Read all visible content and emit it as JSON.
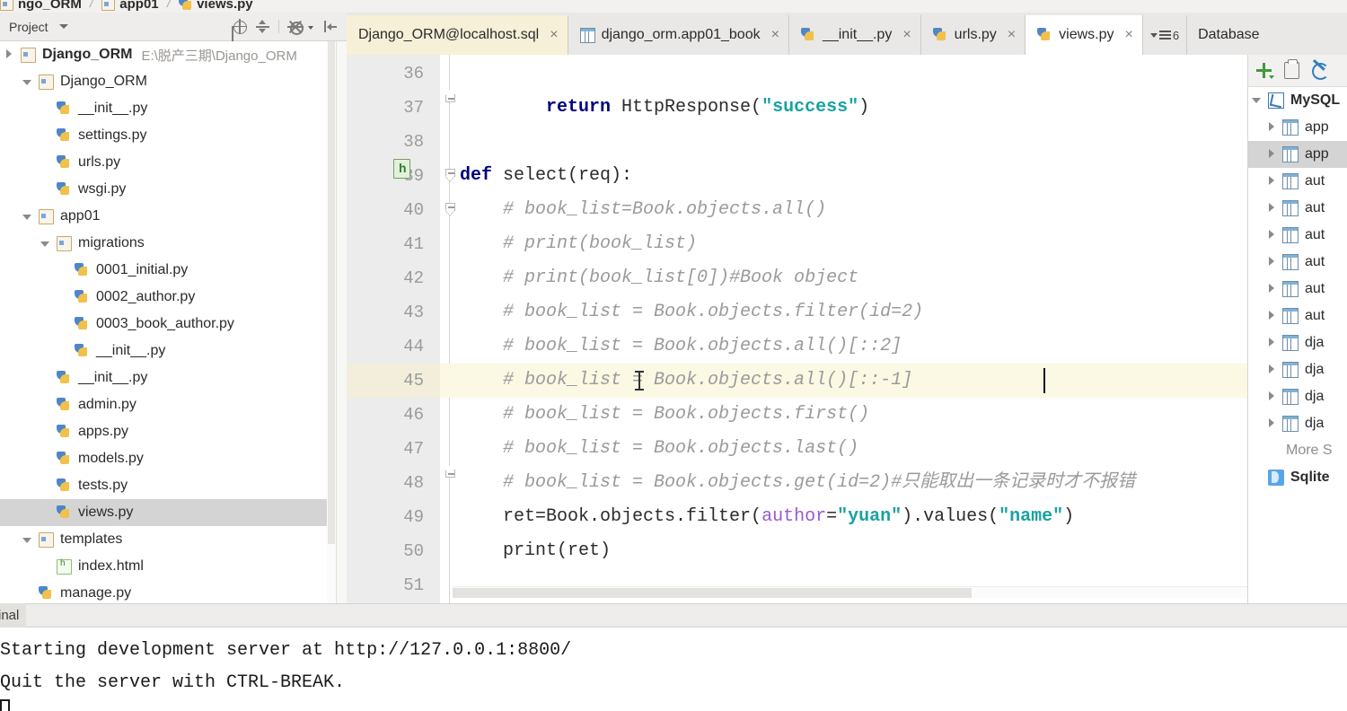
{
  "breadcrumb": {
    "items": [
      {
        "label": "ngo_ORM",
        "icon": "folder-icon"
      },
      {
        "label": "app01",
        "icon": "folder-icon"
      },
      {
        "label": "views.py",
        "icon": "python-file-icon"
      }
    ]
  },
  "project_panel": {
    "title": "Project",
    "toolbar": [
      {
        "name": "locate-file-icon"
      },
      {
        "name": "collapse-all-icon"
      },
      {
        "name": "settings-gear-icon"
      },
      {
        "name": "hide-panel-icon"
      }
    ],
    "tree": [
      {
        "label": "Django_ORM",
        "sub": "E:\\脱产三期\\Django_ORM",
        "icon": "folder-icon",
        "twisty": "closed",
        "indent": 0,
        "bold": true,
        "selected": false
      },
      {
        "label": "Django_ORM",
        "sub": "",
        "icon": "folder-icon",
        "twisty": "open",
        "indent": 1,
        "bold": false,
        "selected": false
      },
      {
        "label": "__init__.py",
        "sub": "",
        "icon": "python-file-icon",
        "twisty": "none",
        "indent": 2,
        "bold": false,
        "selected": false
      },
      {
        "label": "settings.py",
        "sub": "",
        "icon": "python-file-icon",
        "twisty": "none",
        "indent": 2,
        "bold": false,
        "selected": false
      },
      {
        "label": "urls.py",
        "sub": "",
        "icon": "python-file-icon",
        "twisty": "none",
        "indent": 2,
        "bold": false,
        "selected": false
      },
      {
        "label": "wsgi.py",
        "sub": "",
        "icon": "python-file-icon",
        "twisty": "none",
        "indent": 2,
        "bold": false,
        "selected": false
      },
      {
        "label": "app01",
        "sub": "",
        "icon": "folder-icon",
        "twisty": "open",
        "indent": 1,
        "bold": false,
        "selected": false
      },
      {
        "label": "migrations",
        "sub": "",
        "icon": "folder-icon",
        "twisty": "open",
        "indent": 2,
        "bold": false,
        "selected": false
      },
      {
        "label": "0001_initial.py",
        "sub": "",
        "icon": "python-file-icon",
        "twisty": "none",
        "indent": 3,
        "bold": false,
        "selected": false
      },
      {
        "label": "0002_author.py",
        "sub": "",
        "icon": "python-file-icon",
        "twisty": "none",
        "indent": 3,
        "bold": false,
        "selected": false
      },
      {
        "label": "0003_book_author.py",
        "sub": "",
        "icon": "python-file-icon",
        "twisty": "none",
        "indent": 3,
        "bold": false,
        "selected": false
      },
      {
        "label": "__init__.py",
        "sub": "",
        "icon": "python-file-icon",
        "twisty": "none",
        "indent": 3,
        "bold": false,
        "selected": false
      },
      {
        "label": "__init__.py",
        "sub": "",
        "icon": "python-file-icon",
        "twisty": "none",
        "indent": 2,
        "bold": false,
        "selected": false
      },
      {
        "label": "admin.py",
        "sub": "",
        "icon": "python-file-icon",
        "twisty": "none",
        "indent": 2,
        "bold": false,
        "selected": false
      },
      {
        "label": "apps.py",
        "sub": "",
        "icon": "python-file-icon",
        "twisty": "none",
        "indent": 2,
        "bold": false,
        "selected": false
      },
      {
        "label": "models.py",
        "sub": "",
        "icon": "python-file-icon",
        "twisty": "none",
        "indent": 2,
        "bold": false,
        "selected": false
      },
      {
        "label": "tests.py",
        "sub": "",
        "icon": "python-file-icon",
        "twisty": "none",
        "indent": 2,
        "bold": false,
        "selected": false
      },
      {
        "label": "views.py",
        "sub": "",
        "icon": "python-file-icon",
        "twisty": "none",
        "indent": 2,
        "bold": false,
        "selected": true
      },
      {
        "label": "templates",
        "sub": "",
        "icon": "folder-plain-icon",
        "twisty": "open",
        "indent": 1,
        "bold": false,
        "selected": false
      },
      {
        "label": "index.html",
        "sub": "",
        "icon": "html-file-icon",
        "twisty": "none",
        "indent": 2,
        "bold": false,
        "selected": false
      },
      {
        "label": "manage.py",
        "sub": "",
        "icon": "python-file-icon",
        "twisty": "none",
        "indent": 1,
        "bold": false,
        "selected": false
      }
    ]
  },
  "editor_tabs": {
    "tabs": [
      {
        "label": "Django_ORM@localhost.sql",
        "icon": "sql-console-icon",
        "state": "sql",
        "close": "×"
      },
      {
        "label": "django_orm.app01_book",
        "icon": "table-icon",
        "state": "normal",
        "close": "×"
      },
      {
        "label": "__init__.py",
        "icon": "python-file-icon",
        "state": "normal",
        "close": "×"
      },
      {
        "label": "urls.py",
        "icon": "python-file-icon",
        "state": "normal",
        "close": "×"
      },
      {
        "label": "views.py",
        "icon": "python-file-icon",
        "state": "active",
        "close": "×"
      }
    ],
    "overflow_count": "6",
    "database_label": "Database"
  },
  "editor": {
    "filename": "views.py",
    "current_line": 45,
    "lines": [
      {
        "no": "36",
        "tokens": [],
        "fold": "none"
      },
      {
        "no": "37",
        "tokens": [
          {
            "t": "        ",
            "c": "pl"
          },
          {
            "t": "return",
            "c": "k"
          },
          {
            "t": " HttpResponse(",
            "c": "pl"
          },
          {
            "t": "\"success\"",
            "c": "s"
          },
          {
            "t": ")",
            "c": "pl"
          }
        ],
        "fold": "end"
      },
      {
        "no": "38",
        "tokens": [],
        "fold": "none"
      },
      {
        "no": "39",
        "tokens": [
          {
            "t": "def",
            "c": "k"
          },
          {
            "t": " select(req):",
            "c": "pl"
          }
        ],
        "fold": "start",
        "badge": "html-template-icon"
      },
      {
        "no": "40",
        "tokens": [
          {
            "t": "    # book_list=Book.objects.all()",
            "c": "cm"
          }
        ],
        "fold": "start2"
      },
      {
        "no": "41",
        "tokens": [
          {
            "t": "    # print(book_list)",
            "c": "cm"
          }
        ],
        "fold": "none"
      },
      {
        "no": "42",
        "tokens": [
          {
            "t": "    # print(book_list[0])#Book object",
            "c": "cm"
          }
        ],
        "fold": "none"
      },
      {
        "no": "43",
        "tokens": [
          {
            "t": "    # book_list = Book.objects.filter(id=2)",
            "c": "cm"
          }
        ],
        "fold": "none"
      },
      {
        "no": "44",
        "tokens": [
          {
            "t": "    # book_list = Book.objects.all()[::2]",
            "c": "cm"
          }
        ],
        "fold": "none"
      },
      {
        "no": "45",
        "tokens": [
          {
            "t": "    # book_list = Book.objects.all()[::-1]",
            "c": "cm"
          }
        ],
        "fold": "none",
        "highlight": true,
        "caret": true
      },
      {
        "no": "46",
        "tokens": [
          {
            "t": "    # book_list = Book.objects.first()",
            "c": "cm"
          }
        ],
        "fold": "none"
      },
      {
        "no": "47",
        "tokens": [
          {
            "t": "    # book_list = Book.objects.last()",
            "c": "cm"
          }
        ],
        "fold": "none"
      },
      {
        "no": "48",
        "tokens": [
          {
            "t": "    # book_list = Book.objects.get(id=2)#只能取出一条记录时才不报错",
            "c": "cm"
          }
        ],
        "fold": "end"
      },
      {
        "no": "49",
        "tokens": [
          {
            "t": "    ret=Book.objects.filter(",
            "c": "pl"
          },
          {
            "t": "author",
            "c": "kw"
          },
          {
            "t": "=",
            "c": "pl"
          },
          {
            "t": "\"yuan\"",
            "c": "s"
          },
          {
            "t": ").values(",
            "c": "pl"
          },
          {
            "t": "\"name\"",
            "c": "s"
          },
          {
            "t": ")",
            "c": "pl"
          }
        ],
        "fold": "none"
      },
      {
        "no": "50",
        "tokens": [
          {
            "t": "    print(ret)",
            "c": "pl"
          }
        ],
        "fold": "none"
      },
      {
        "no": "51",
        "tokens": [],
        "fold": "none"
      }
    ],
    "error_badge": "error-indicator-icon"
  },
  "database_panel": {
    "toolbar": [
      {
        "name": "add-data-source-icon"
      },
      {
        "name": "copy-icon"
      },
      {
        "name": "synchronize-icon"
      }
    ],
    "items": [
      {
        "label": "MySQL",
        "icon": "mysql-icon",
        "twisty": "open",
        "indent": 0,
        "bold": true,
        "selected": false
      },
      {
        "label": "app",
        "icon": "table-icon",
        "twisty": "closed",
        "indent": 1,
        "bold": false,
        "selected": false
      },
      {
        "label": "app",
        "icon": "table-icon",
        "twisty": "closed",
        "indent": 1,
        "bold": false,
        "selected": true
      },
      {
        "label": "aut",
        "icon": "table-icon",
        "twisty": "closed",
        "indent": 1,
        "bold": false,
        "selected": false
      },
      {
        "label": "aut",
        "icon": "table-icon",
        "twisty": "closed",
        "indent": 1,
        "bold": false,
        "selected": false
      },
      {
        "label": "aut",
        "icon": "table-icon",
        "twisty": "closed",
        "indent": 1,
        "bold": false,
        "selected": false
      },
      {
        "label": "aut",
        "icon": "table-icon",
        "twisty": "closed",
        "indent": 1,
        "bold": false,
        "selected": false
      },
      {
        "label": "aut",
        "icon": "table-icon",
        "twisty": "closed",
        "indent": 1,
        "bold": false,
        "selected": false
      },
      {
        "label": "aut",
        "icon": "table-icon",
        "twisty": "closed",
        "indent": 1,
        "bold": false,
        "selected": false
      },
      {
        "label": "dja",
        "icon": "table-icon",
        "twisty": "closed",
        "indent": 1,
        "bold": false,
        "selected": false
      },
      {
        "label": "dja",
        "icon": "table-icon",
        "twisty": "closed",
        "indent": 1,
        "bold": false,
        "selected": false
      },
      {
        "label": "dja",
        "icon": "table-icon",
        "twisty": "closed",
        "indent": 1,
        "bold": false,
        "selected": false
      },
      {
        "label": "dja",
        "icon": "table-icon",
        "twisty": "closed",
        "indent": 1,
        "bold": false,
        "selected": false
      }
    ],
    "more_label": "More S",
    "sqlite_label": "Sqlite"
  },
  "terminal": {
    "tab_label": "inal",
    "lines": [
      "Starting development server at http://127.0.0.1:8800/",
      "Quit the server with CTRL-BREAK."
    ]
  }
}
